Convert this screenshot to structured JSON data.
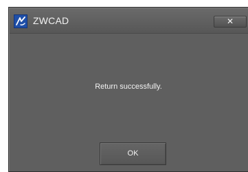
{
  "window": {
    "title": "ZWCAD",
    "app_icon": "zwcad-logo-icon",
    "close_label": "✕"
  },
  "dialog": {
    "message": "Return successfully.",
    "ok_label": "OK"
  },
  "colors": {
    "dialog_background": "#5f5f5f",
    "icon_background": "#1f4fa8",
    "text": "#f2f2f2"
  }
}
